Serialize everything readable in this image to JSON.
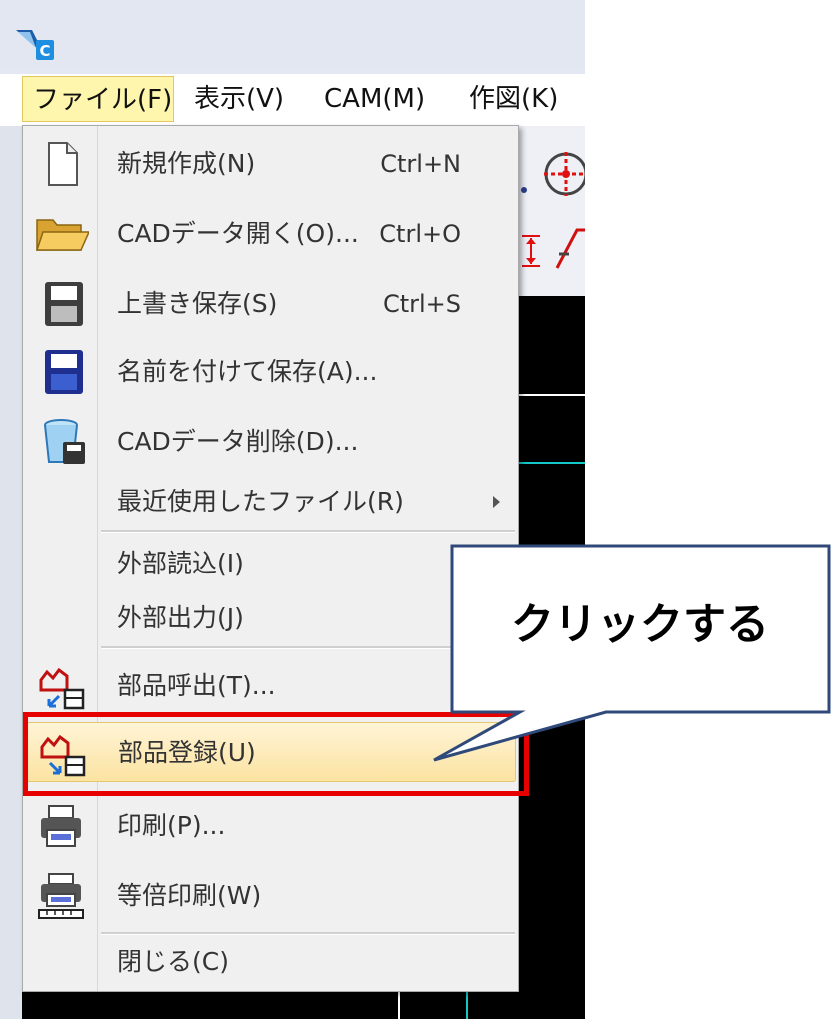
{
  "menu_bar": {
    "items": [
      {
        "label": "ファイル(F)",
        "active": true
      },
      {
        "label": "表示(V)"
      },
      {
        "label": "CAM(M)"
      },
      {
        "label": "作図(K)"
      }
    ]
  },
  "file_menu": {
    "items": [
      {
        "label": "新規作成(N)",
        "shortcut": "Ctrl+N",
        "icon": "new-file-icon"
      },
      {
        "label": "CADデータ開く(O)...",
        "shortcut": "Ctrl+O",
        "icon": "folder-open-icon"
      },
      {
        "label": "上書き保存(S)",
        "shortcut": "Ctrl+S",
        "icon": "save-icon"
      },
      {
        "label": "名前を付けて保存(A)...",
        "icon": "save-as-icon"
      },
      {
        "label": "CADデータ削除(D)...",
        "icon": "trash-icon"
      },
      {
        "label": "最近使用したファイル(R)",
        "submenu": true
      },
      {
        "label": "外部読込(I)"
      },
      {
        "label": "外部出力(J)"
      },
      {
        "label": "部品呼出(T)...",
        "icon": "part-call-icon"
      },
      {
        "label": "部品登録(U)",
        "icon": "part-register-icon",
        "highlighted": true
      },
      {
        "label": "印刷(P)...",
        "icon": "printer-icon"
      },
      {
        "label": "等倍印刷(W)",
        "icon": "printer-scale-icon"
      },
      {
        "label": "閉じる(C)"
      }
    ]
  },
  "callout": {
    "text": "クリックする"
  },
  "colors": {
    "highlight_border": "#e60000",
    "callout_border": "#2f4a7a",
    "hover_background": "#fbe3a1",
    "menu_active_background": "#fff6ad"
  }
}
